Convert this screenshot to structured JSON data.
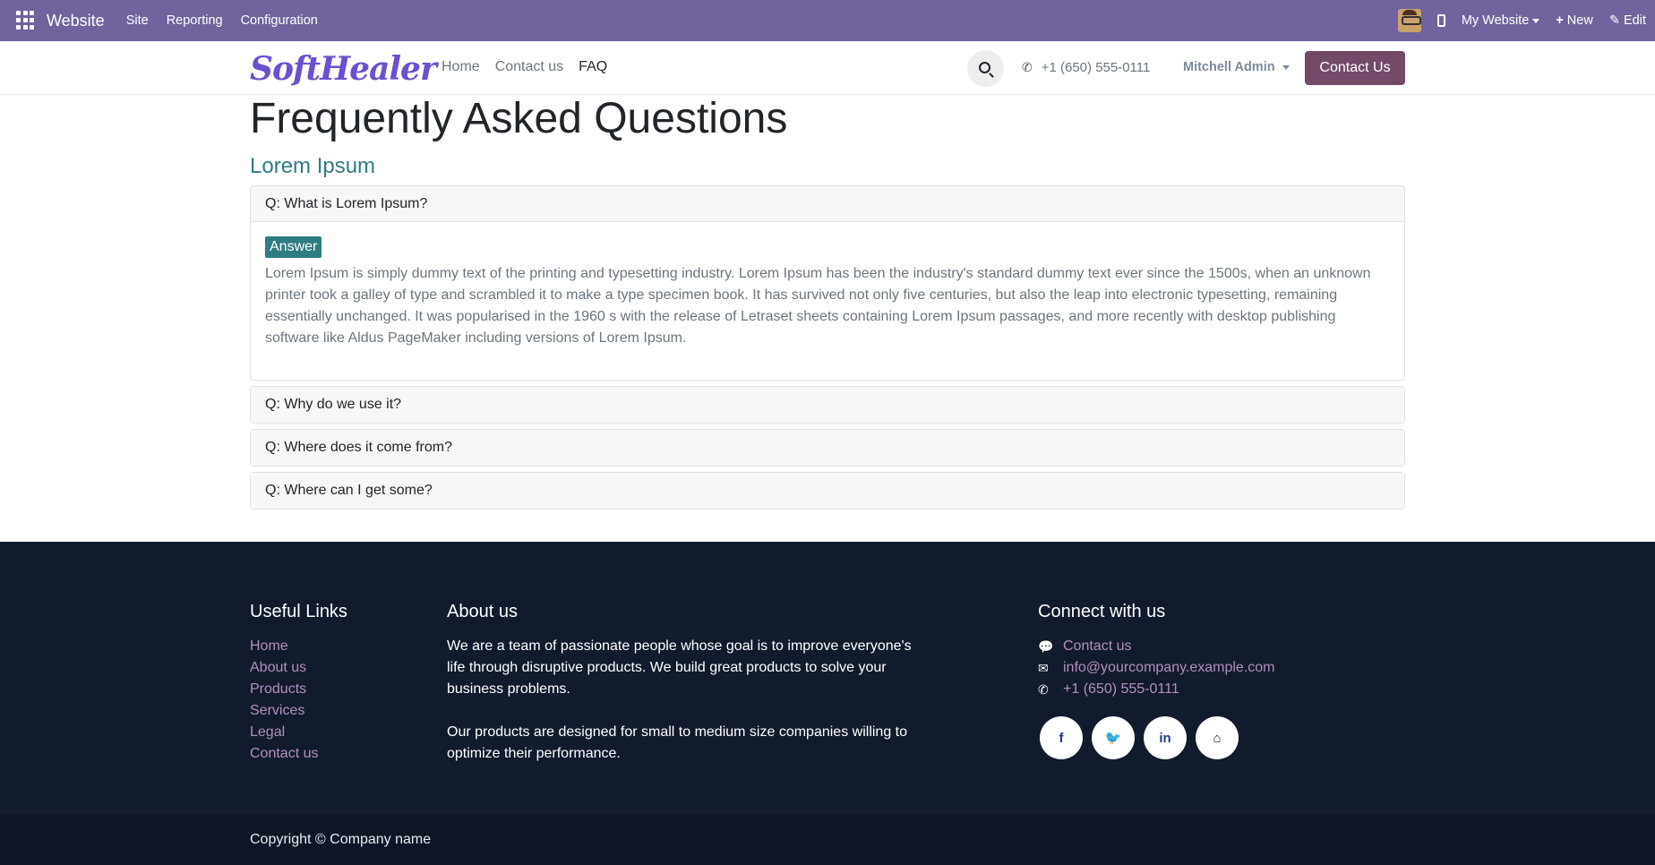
{
  "adminbar": {
    "app_name": "Website",
    "menus": [
      "Site",
      "Reporting",
      "Configuration"
    ],
    "website_switcher": "My Website",
    "new_label": "New",
    "edit_label": "Edit"
  },
  "header": {
    "logo_text": "SoftHealer",
    "nav": [
      "Home",
      "Contact us",
      "FAQ"
    ],
    "active_nav": "FAQ",
    "phone": "+1 (650) 555-0111",
    "user": "Mitchell Admin",
    "cta": "Contact Us"
  },
  "main": {
    "title": "Frequently Asked Questions",
    "section": "Lorem Ipsum",
    "faqs": [
      {
        "question": "Q: What is Lorem Ipsum?",
        "answer_label": "Answer",
        "answer": "Lorem Ipsum is simply dummy text of the printing and typesetting industry. Lorem Ipsum has been the industry's standard dummy text ever since the 1500s, when an unknown printer took a galley of type and scrambled it to make a type specimen book. It has survived not only five centuries, but also the leap into electronic typesetting, remaining essentially unchanged. It was popularised in the 1960 s with the release of Letraset sheets containing Lorem Ipsum passages, and more recently with desktop publishing software like Aldus PageMaker including versions of Lorem Ipsum."
      },
      {
        "question": "Q: Why do we use it?"
      },
      {
        "question": "Q: Where does it come from?"
      },
      {
        "question": "Q: Where can I get some?"
      }
    ]
  },
  "footer": {
    "useful_links_title": "Useful Links",
    "useful_links": [
      "Home",
      "About us",
      "Products",
      "Services",
      "Legal",
      "Contact us"
    ],
    "about_title": "About us",
    "about_p1": "We are a team of passionate people whose goal is to improve everyone's life through disruptive products. We build great products to solve your business problems.",
    "about_p2": "Our products are designed for small to medium size companies willing to optimize their performance.",
    "connect_title": "Connect with us",
    "contact_us": "Contact us",
    "email": "info@yourcompany.example.com",
    "phone": "+1 (650) 555-0111",
    "socials": [
      "facebook-icon",
      "twitter-icon",
      "linkedin-icon",
      "home-icon"
    ],
    "copyright": "Copyright © Company name"
  }
}
